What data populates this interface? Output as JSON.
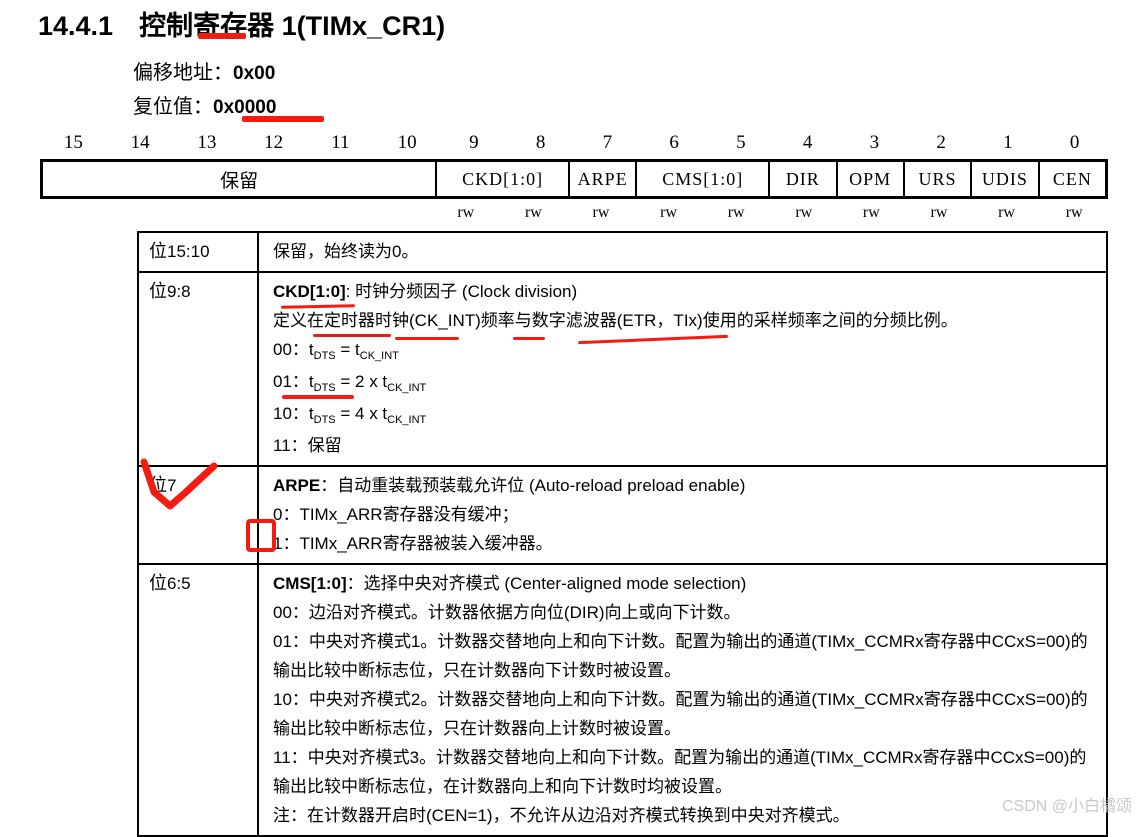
{
  "heading": {
    "number": "14.4.1",
    "title": "控制寄存器 1(TIMx_CR1)"
  },
  "meta": {
    "offset_label": "偏移地址：",
    "offset_value": "0x00",
    "reset_label": "复位值：",
    "reset_value": "0x0000"
  },
  "bit_numbers": [
    "15",
    "14",
    "13",
    "12",
    "11",
    "10",
    "9",
    "8",
    "7",
    "6",
    "5",
    "4",
    "3",
    "2",
    "1",
    "0"
  ],
  "register_fields": [
    {
      "name": "保留",
      "bits": 6,
      "style": "reserved"
    },
    {
      "name": "CKD[1:0]",
      "bits": 2,
      "style": "normal"
    },
    {
      "name": "ARPE",
      "bits": 1,
      "style": "normal"
    },
    {
      "name": "CMS[1:0]",
      "bits": 2,
      "style": "normal"
    },
    {
      "name": "DIR",
      "bits": 1,
      "style": "normal"
    },
    {
      "name": "OPM",
      "bits": 1,
      "style": "normal"
    },
    {
      "name": "URS",
      "bits": 1,
      "style": "normal"
    },
    {
      "name": "UDIS",
      "bits": 1,
      "style": "normal"
    },
    {
      "name": "CEN",
      "bits": 1,
      "style": "normal"
    }
  ],
  "access_row": [
    "rw",
    "rw",
    "rw",
    "rw",
    "rw",
    "rw",
    "rw",
    "rw",
    "rw",
    "rw"
  ],
  "descriptions": [
    {
      "bits": "位15:10",
      "lines": [
        {
          "text": "保留，始终读为0。"
        }
      ]
    },
    {
      "bits": "位9:8",
      "lines": [
        {
          "bold_prefix": "CKD[1:0]",
          "text": ": 时钟分频因子 (Clock division)"
        },
        {
          "text": "定义在定时器时钟(CK_INT)频率与数字滤波器(ETR，TIx)使用的采样频率之间的分频比例。"
        },
        {
          "text": "00：t<DTS> = t<CK_INT>"
        },
        {
          "text": "01：t<DTS> = 2 x t<CK_INT>"
        },
        {
          "text": "10：t<DTS> = 4 x t<CK_INT>"
        },
        {
          "text": "11：保留"
        }
      ]
    },
    {
      "bits": "位7",
      "lines": [
        {
          "bold_prefix": "ARPE",
          "text": "：自动重装载预装载允许位 (Auto-reload preload enable)"
        },
        {
          "text": "0：TIMx_ARR寄存器没有缓冲；"
        },
        {
          "text": "1：TIMx_ARR寄存器被装入缓冲器。"
        }
      ]
    },
    {
      "bits": "位6:5",
      "lines": [
        {
          "bold_prefix": "CMS[1:0]",
          "text": "：选择中央对齐模式 (Center-aligned mode selection)"
        },
        {
          "text": "00：边沿对齐模式。计数器依据方向位(DIR)向上或向下计数。"
        },
        {
          "text": "01：中央对齐模式1。计数器交替地向上和向下计数。配置为输出的通道(TIMx_CCMRx寄存器中CCxS=00)的输出比较中断标志位，只在计数器向下计数时被设置。"
        },
        {
          "text": "10：中央对齐模式2。计数器交替地向上和向下计数。配置为输出的通道(TIMx_CCMRx寄存器中CCxS=00)的输出比较中断标志位，只在计数器向上计数时被设置。"
        },
        {
          "text": "11：中央对齐模式3。计数器交替地向上和向下计数。配置为输出的通道(TIMx_CCMRx寄存器中CCxS=00)的输出比较中断标志位，在计数器向上和向下计数时均被设置。"
        },
        {
          "text": "注：在计数器开启时(CEN=1)，不允许从边沿对齐模式转换到中央对齐模式。"
        }
      ]
    }
  ],
  "annotations": {
    "checkmark_target": "位7",
    "boxed_target": "1:",
    "color": "#f51b10"
  },
  "watermark": "CSDN @小白橘颂"
}
